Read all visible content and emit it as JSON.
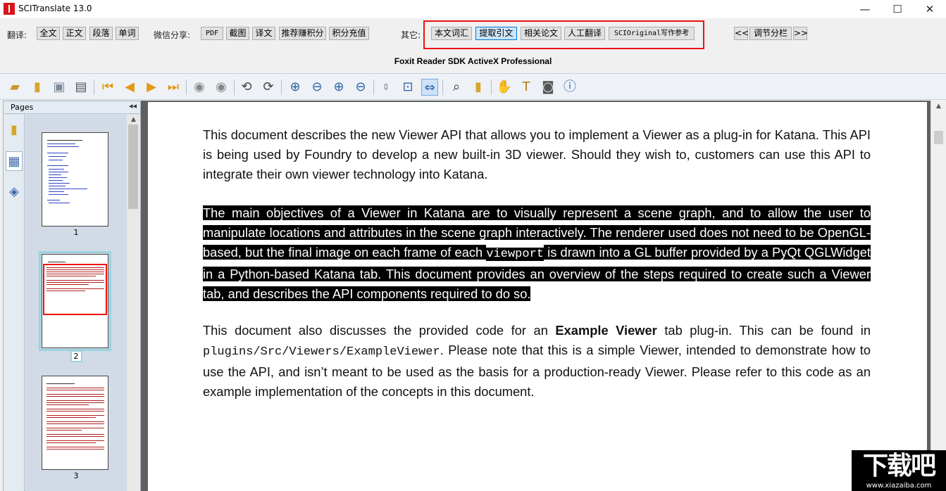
{
  "window": {
    "title": "SCITranslate 13.0",
    "controls": {
      "minimize": "—",
      "maximize": "☐",
      "close": "✕"
    }
  },
  "translate_toolbar": {
    "translate_label": "翻译:",
    "translate_buttons": [
      "全文",
      "正文",
      "段落",
      "单词"
    ],
    "wechat_label": "微信分享:",
    "wechat_buttons": [
      "PDF",
      "截图",
      "译文",
      "推荐赚积分",
      "积分充值"
    ],
    "other_label": "其它:",
    "other_buttons": [
      "本文词汇",
      "提取引文",
      "相关论文",
      "人工翻译",
      "SCIOriginal写作参考"
    ],
    "nav_buttons": [
      "<<",
      "调节分栏",
      ">>"
    ]
  },
  "viewer": {
    "caption": "Foxit Reader SDK ActiveX Professional",
    "toolbar_icons": [
      "open-folder-icon",
      "open-file-icon",
      "save-icon",
      "print-icon",
      "first-page-icon",
      "previous-page-icon",
      "next-page-icon",
      "last-page-icon",
      "back-icon",
      "forward-icon",
      "rotate-left-icon",
      "rotate-right-icon",
      "zoom-in-icon",
      "zoom-out-icon",
      "zoom-plus-icon",
      "zoom-minus-icon",
      "actual-size-icon",
      "fit-page-icon",
      "fit-width-icon",
      "find-icon",
      "bookmark-icon",
      "hand-tool-icon",
      "text-select-icon",
      "snapshot-icon",
      "info-icon"
    ]
  },
  "pages_panel": {
    "title": "Pages",
    "collapse": "◂◂",
    "thumbnails": [
      {
        "number": "1",
        "selected": false
      },
      {
        "number": "2",
        "selected": true
      },
      {
        "number": "3",
        "selected": false
      }
    ]
  },
  "document": {
    "p1": "This document describes the new Viewer API that allows you to implement a Viewer as a plug-in for Katana. This API is being used by Foundry to develop a new built-in 3D viewer. Should they wish to, customers can use this API to integrate their own viewer technology into Katana.",
    "p2_a": "The main objectives of a Viewer in Katana are to visually represent a scene graph, and to allow the user to manipulate locations and attributes in the scene graph interactively. The renderer used does not need to be OpenGL-based, but the final image on each frame of each ",
    "p2_code": "viewport",
    "p2_b": " is drawn into a GL buffer provided by a PyQt QGLWidget in a Python-based Katana tab. This document provides an overview of the steps required to create such a Viewer tab, and describes the API components required to do so.",
    "p3_a": "This document also discusses the provided code for an ",
    "p3_bold": "Example Viewer",
    "p3_b": " tab plug-in. This can be found in ",
    "p3_code": "plugins/Src/Viewers/ExampleViewer",
    "p3_c": ". Please note that this is a simple Viewer, intended to demonstrate how to use the API, and isn’t meant to be used as the basis for a production-ready Viewer. Please refer to this code as an example implementation of the concepts in this document."
  },
  "watermark": {
    "main": "下载吧",
    "url": "www.xiazaiba.com"
  }
}
